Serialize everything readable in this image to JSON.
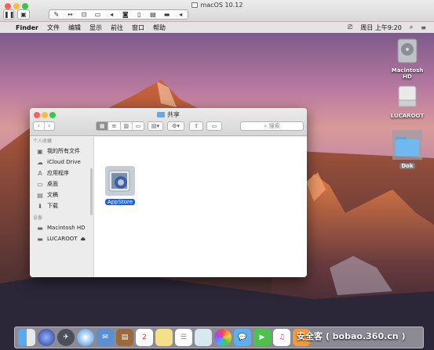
{
  "vm": {
    "title": "macOS 10.12",
    "pause_icon": "pause-icon",
    "screenshot_icon": "screen-icon",
    "tools": [
      "wrench-icon",
      "arrows-icon",
      "usb-icon",
      "drive-icon",
      "speaker-icon",
      "camera-icon",
      "phone-icon",
      "lock-icon",
      "folder-icon",
      "left-arrow-icon"
    ]
  },
  "menubar": {
    "apple": "",
    "app": "Finder",
    "items": [
      "文件",
      "编辑",
      "显示",
      "前往",
      "窗口",
      "帮助"
    ],
    "clock": "周日 上午9:20",
    "icons": [
      "display-icon",
      "search-icon",
      "list-icon"
    ]
  },
  "desktop_icons": [
    {
      "label": "Macintosh HD",
      "icon": "hard-drive-icon"
    },
    {
      "label": "LUCAROOT",
      "icon": "external-drive-icon"
    },
    {
      "label": "Dok",
      "icon": "folder-icon"
    }
  ],
  "finder": {
    "title": "共享",
    "search_placeholder": "搜索",
    "sidebar": {
      "favorites_header": "个人收藏",
      "favorites": [
        {
          "label": "我的所有文件",
          "icon": "all-files-icon"
        },
        {
          "label": "iCloud Drive",
          "icon": "cloud-icon"
        },
        {
          "label": "应用程序",
          "icon": "applications-icon"
        },
        {
          "label": "桌面",
          "icon": "desktop-icon"
        },
        {
          "label": "文稿",
          "icon": "documents-icon"
        },
        {
          "label": "下载",
          "icon": "downloads-icon"
        }
      ],
      "devices_header": "设备",
      "devices": [
        {
          "label": "Macintosh HD",
          "icon": "hard-drive-icon"
        },
        {
          "label": "LUCAROOT",
          "icon": "external-drive-icon"
        }
      ]
    },
    "items": [
      {
        "label": "AppStore",
        "icon": "app-store-icon"
      }
    ]
  },
  "dock": {
    "calendar_day": "2"
  },
  "watermark": "安全客 ( bobao.360.cn )",
  "colors": {
    "selection_blue": "#1d62d8",
    "folder_blue": "#64a8e8",
    "close_red": "#fc605c",
    "minimize_yellow": "#fdbc40",
    "zoom_green": "#34c84a"
  }
}
